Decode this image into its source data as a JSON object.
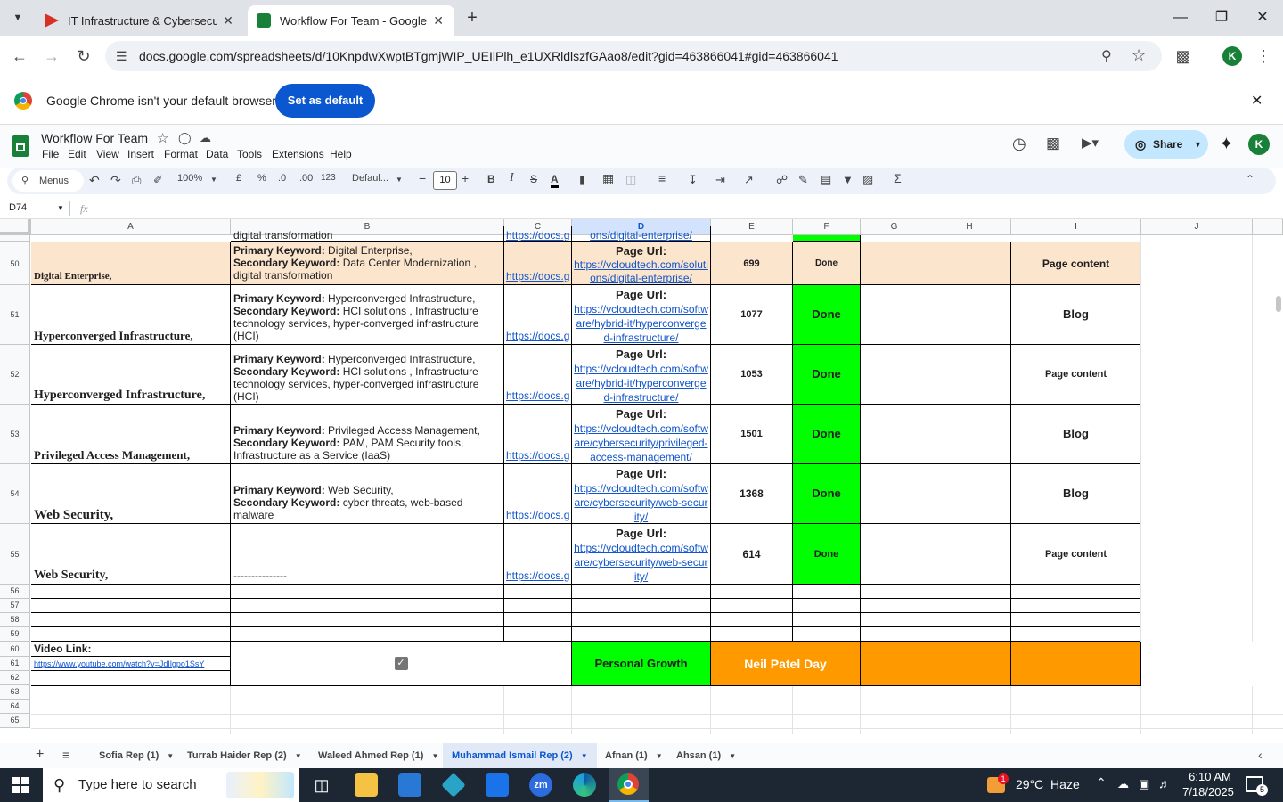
{
  "browser": {
    "tabs": [
      {
        "title": "IT Infrastructure & Cybersecurit",
        "active": false
      },
      {
        "title": "Workflow For Team - Google Sh",
        "active": true
      }
    ],
    "url": "docs.google.com/spreadsheets/d/10KnpdwXwptBTgmjWIP_UEIlPlh_e1UXRldlszfGAao8/edit?gid=463866041#gid=463866041",
    "profile_initial": "K"
  },
  "infobar": {
    "message": "Google Chrome isn't your default browser",
    "button": "Set as default"
  },
  "sheets": {
    "doc_title": "Workflow For Team",
    "menus": [
      "File",
      "Edit",
      "View",
      "Insert",
      "Format",
      "Data",
      "Tools",
      "Extensions",
      "Help"
    ],
    "share_label": "Share",
    "user_initial": "K",
    "toolbar": {
      "search": "Menus",
      "zoom": "100%",
      "currency": "£",
      "percent": "%",
      "dec_less": ".0",
      "dec_more": ".00",
      "number_fmt": "123",
      "font": "Defaul...",
      "font_size": "10"
    },
    "name_box": "D74",
    "fx": "fx"
  },
  "grid": {
    "columns": [
      "A",
      "B",
      "C",
      "D",
      "E",
      "F",
      "G",
      "H",
      "I",
      "J"
    ],
    "selected_column": "D",
    "partial_row": {
      "b": "digital transformation",
      "c": "https://docs.g",
      "d": "ons/digital-enterprise/"
    },
    "rows": [
      {
        "num": "50",
        "a": "Digital Enterprise,",
        "b_pk": "Digital Enterprise,",
        "b_sk": "Data Center Modernization ,",
        "b_extra": "digital transformation",
        "c": "https://docs.g",
        "d_label": "Page Url:",
        "d_link": "https://vcloudtech.com/solutions/digital-enterprise/",
        "e": "699",
        "f": "Done",
        "i": "Page content"
      },
      {
        "num": "51",
        "a": "Hyperconverged Infrastructure,",
        "b_pk": "Hyperconverged Infrastructure,",
        "b_sk": "HCI solutions , Infrastructure technology services, hyper-converged infrastructure (HCI)",
        "b_extra": "",
        "c": "https://docs.g",
        "d_label": "Page Url:",
        "d_link": "https://vcloudtech.com/software/hybrid-it/hyperconverged-infrastructure/",
        "e": "1077",
        "f": "Done",
        "i": "Blog"
      },
      {
        "num": "52",
        "a": "Hyperconverged Infrastructure,",
        "b_pk": "Hyperconverged Infrastructure,",
        "b_sk": "HCI solutions , Infrastructure technology services, hyper-converged infrastructure (HCI)",
        "b_extra": "",
        "c": "https://docs.g",
        "d_label": "Page Url:",
        "d_link": "https://vcloudtech.com/software/hybrid-it/hyperconverged-infrastructure/",
        "e": "1053",
        "f": "Done",
        "i": "Page content"
      },
      {
        "num": "53",
        "a": "Privileged Access Management,",
        "b_pk": "Privileged Access Management,",
        "b_sk": "PAM, PAM Security tools, Infrastructure as a Service (IaaS)",
        "b_extra": "",
        "c": "https://docs.g",
        "d_label": "Page Url:",
        "d_link": "https://vcloudtech.com/software/cybersecurity/privileged-access-management/",
        "e": "1501",
        "f": "Done",
        "i": "Blog"
      },
      {
        "num": "54",
        "a": "Web Security,",
        "b_pk": "Web Security,",
        "b_sk": "cyber threats, web-based malware",
        "b_extra": "",
        "c": "https://docs.g",
        "d_label": "Page Url:",
        "d_link": "https://vcloudtech.com/software/cybersecurity/web-security/",
        "e": "1368",
        "f": "Done",
        "i": "Blog"
      },
      {
        "num": "55",
        "a": "Web Security,",
        "b_text": "---------------",
        "c": "https://docs.g",
        "d_label": "Page Url:",
        "d_link": "https://vcloudtech.com/software/cybersecurity/web-security/",
        "e": "614",
        "f": "Done",
        "i": "Page content"
      }
    ],
    "empty_rows": [
      "56",
      "57",
      "58",
      "59"
    ],
    "bottom_rows": [
      "60",
      "61",
      "62",
      "63",
      "64",
      "65"
    ],
    "pk_label": "Primary Keyword:",
    "sk_label": "Secondary Keyword:",
    "video_label": "Video Link:",
    "video_url": "https://www.youtube.com/watch?v=JdIlgpo1SsY",
    "personal_growth": "Personal Growth",
    "neil_patel": "Neil Patel Day"
  },
  "sheet_tabs": [
    "Sofia Rep (1)",
    "Turrab Haider Rep (2)",
    "Waleed Ahmed Rep (1)",
    "Muhammad Ismail Rep (2)",
    "Afnan (1)",
    "Ahsan (1)"
  ],
  "active_sheet_tab": "Muhammad Ismail Rep (2)",
  "taskbar": {
    "search_placeholder": "Type here to search",
    "weather": "29°C  Haze",
    "weather_badge": "1",
    "time": "6:10 AM",
    "date": "7/18/2025",
    "notif_count": "5"
  },
  "colors": {
    "green": "#00ff00",
    "orange": "#ff9900",
    "peach": "#fce5cd",
    "link": "#1155cc",
    "accent": "#0b57d0"
  }
}
